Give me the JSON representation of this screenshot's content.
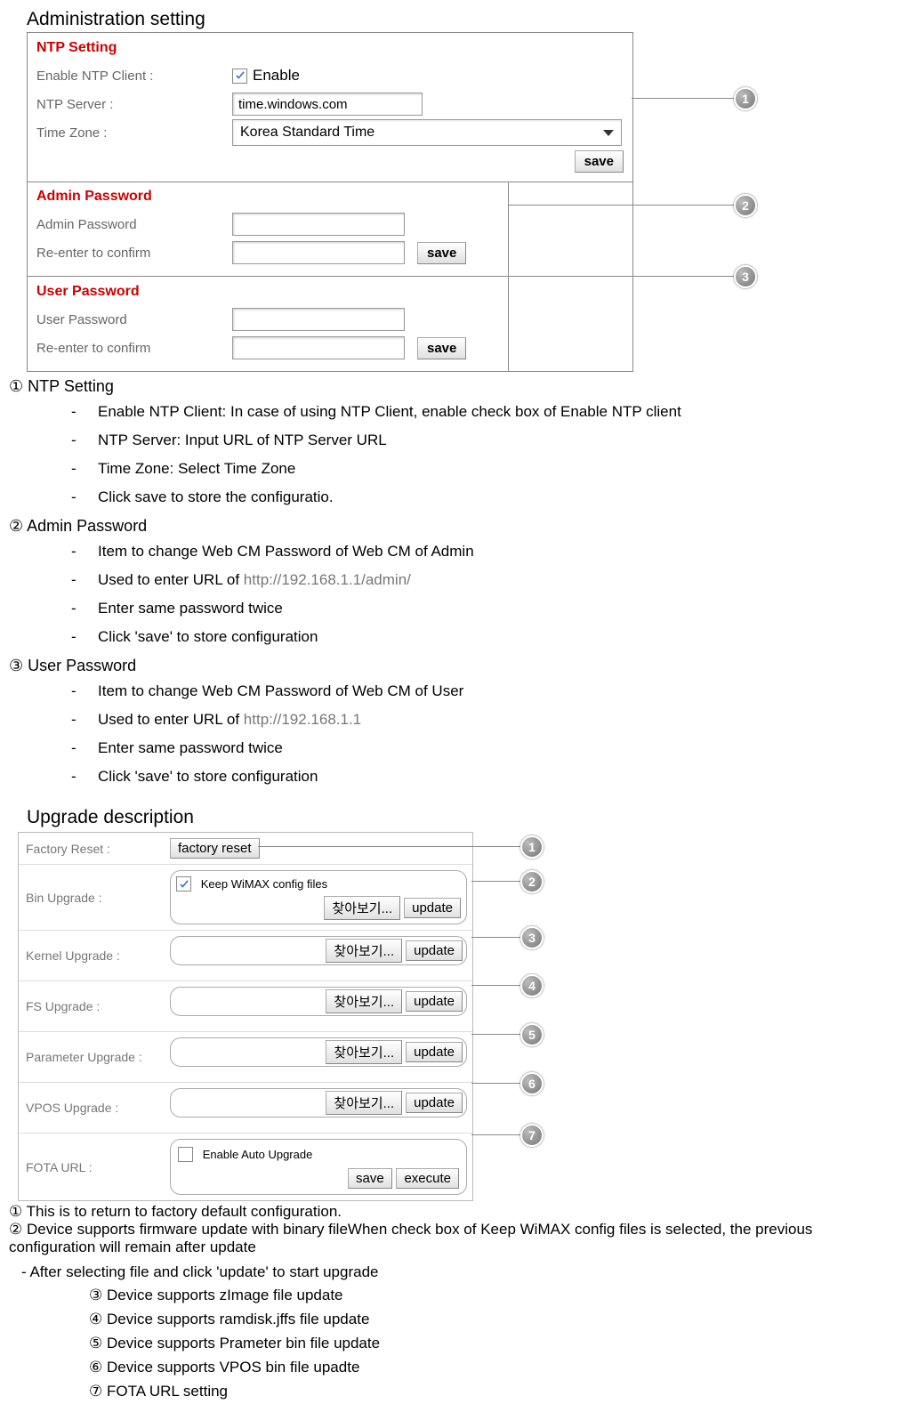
{
  "admin": {
    "title": "Administration setting",
    "ntp": {
      "header": "NTP Setting",
      "enable_label": "Enable NTP Client :",
      "enable_text": "Enable",
      "server_label": "NTP Server :",
      "server_value": "time.windows.com",
      "tz_label": "Time Zone :",
      "tz_value": "Korea Standard Time",
      "save": "save"
    },
    "admin_pwd": {
      "header": "Admin Password",
      "pwd_label": "Admin Password",
      "confirm_label": "Re-enter to confirm",
      "save": "save"
    },
    "user_pwd": {
      "header": "User Password",
      "pwd_label": "User Password",
      "confirm_label": "Re-enter to confirm",
      "save": "save"
    },
    "callouts": {
      "c1": "1",
      "c2": "2",
      "c3": "3"
    }
  },
  "admin_desc": {
    "h1": "① NTP Setting",
    "l1a": "Enable NTP Client: In case of using NTP Client, enable check box of Enable NTP client",
    "l1b": "NTP Server: Input URL of NTP Server URL",
    "l1c": "Time Zone: Select Time Zone",
    "l1d": "Click save to store the configuratio.",
    "h2": "② Admin Password",
    "l2a": "Item to change Web CM Password of Web CM of Admin",
    "l2b_pre": "Used to enter URL of ",
    "l2b_url": "http://192.168.1.1/admin/",
    "l2c": "Enter same password twice",
    "l2d": "Click 'save' to store configuration",
    "h3": "③ User Password",
    "l3a": "Item to change Web CM Password of Web CM of User",
    "l3b_pre": "Used to enter URL of ",
    "l3b_url": "http://192.168.1.1",
    "l3c": "Enter same password twice",
    "l3d": "Click 'save' to store configuration"
  },
  "upgrade": {
    "title": "Upgrade description",
    "rows": {
      "factory": {
        "label": "Factory Reset :",
        "btn": "factory reset"
      },
      "bin": {
        "label": "Bin Upgrade :",
        "keep": "Keep WiMAX config files",
        "browse": "찾아보기...",
        "update": "update"
      },
      "kernel": {
        "label": "Kernel Upgrade :",
        "browse": "찾아보기...",
        "update": "update"
      },
      "fs": {
        "label": "FS Upgrade :",
        "browse": "찾아보기...",
        "update": "update"
      },
      "param": {
        "label": "Parameter Upgrade :",
        "browse": "찾아보기...",
        "update": "update"
      },
      "vpos": {
        "label": "VPOS Upgrade :",
        "browse": "찾아보기...",
        "update": "update"
      },
      "fota": {
        "label": "FOTA URL :",
        "enable": "Enable Auto Upgrade",
        "save": "save",
        "execute": "execute"
      }
    },
    "callouts": {
      "c1": "1",
      "c2": "2",
      "c3": "3",
      "c4": "4",
      "c5": "5",
      "c6": "6",
      "c7": "7"
    }
  },
  "upgrade_desc": {
    "p1": "① This is to return to factory default configuration.",
    "p2": "② Device supports firmware update with binary fileWhen check box of Keep WiMAX config files is selected, the previous configuration will remain after update",
    "after": "-  After selecting file and click 'update' to start upgrade",
    "n3": "③ Device supports zImage file update",
    "n4": "④ Device supports ramdisk.jffs file update",
    "n5": "⑤ Device supports Prameter bin file update",
    "n6": "⑥ Device supports VPOS bin file upadte",
    "n7": "⑦ FOTA URL setting"
  }
}
